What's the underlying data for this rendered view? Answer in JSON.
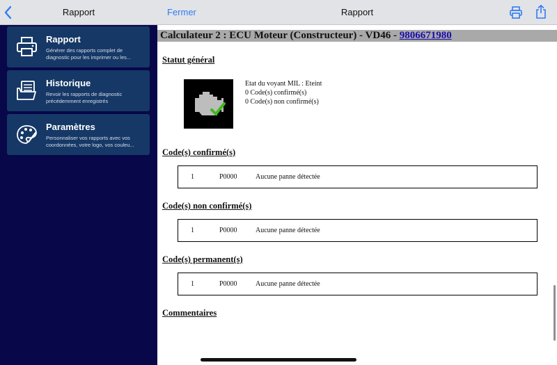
{
  "sidebar": {
    "title": "Rapport",
    "items": [
      {
        "title": "Rapport",
        "desc_line1": "Générer des rapports complet de",
        "desc_line2": "diagnostic pour les imprimer ou les..."
      },
      {
        "title": "Historique",
        "desc_line1": "Revoir les rapports de diagnostic",
        "desc_line2": "précédemment enregistrés"
      },
      {
        "title": "Paramètres",
        "desc_line1": "Personnaliser vos rapports avec vos",
        "desc_line2": "coordonnées, votre logo, vos couleu..."
      }
    ]
  },
  "header": {
    "close_label": "Fermer",
    "title": "Rapport"
  },
  "report": {
    "ecu_title": "Calculateur 2 : ECU Moteur (Constructeur) - VD46 - ",
    "ecu_link": "9806671980",
    "status_title": "Statut général",
    "mil_status": "Etat du voyant MIL : Eteint",
    "confirmed_count": "0 Code(s) confirmé(s)",
    "unconfirmed_count": "0 Code(s) non confirmé(s)",
    "sections": [
      {
        "title": "Code(s) confirmé(s)",
        "row": {
          "num": "1",
          "code": "P0000",
          "desc": "Aucune panne détectée"
        }
      },
      {
        "title": "Code(s) non confirmé(s)",
        "row": {
          "num": "1",
          "code": "P0000",
          "desc": "Aucune panne détectée"
        }
      },
      {
        "title": "Code(s) permanent(s)",
        "row": {
          "num": "1",
          "code": "P0000",
          "desc": "Aucune panne détectée"
        }
      }
    ],
    "comments_title": "Commentaires"
  },
  "colors": {
    "sidebar_bg": "#07074a",
    "card_bg": "#163866",
    "accent": "#2f7cf6",
    "banner_bg": "#a9a9a9",
    "check_green": "#3fb81c"
  },
  "icons": [
    "chevron-left-icon",
    "printer-icon",
    "share-icon",
    "document-stack-icon",
    "palette-icon",
    "engine-check-icon"
  ]
}
